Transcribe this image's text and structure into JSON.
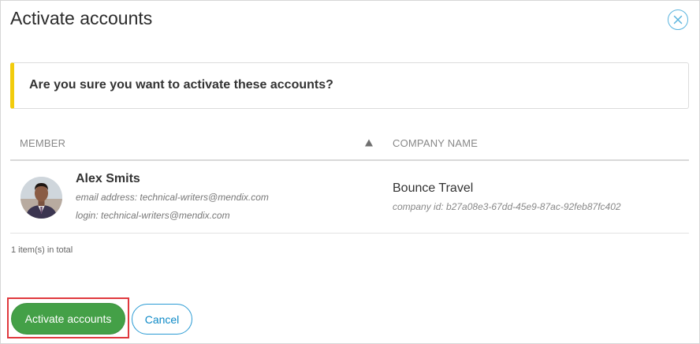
{
  "dialog": {
    "title": "Activate accounts",
    "close_icon": "close-circle-icon"
  },
  "alert": {
    "message": "Are you sure you want to activate these accounts?",
    "accent_color": "#f2cc0c"
  },
  "table": {
    "columns": [
      {
        "label": "MEMBER",
        "sort": "ascending"
      },
      {
        "label": "COMPANY NAME"
      }
    ],
    "rows": [
      {
        "member_name": "Alex Smits",
        "email": "email address: technical-writers@mendix.com",
        "login": "login: technical-writers@mendix.com",
        "company_name": "Bounce Travel",
        "company_id": "company id: b27a08e3-67dd-45e9-87ac-92feb87fc402"
      }
    ],
    "total": "1 item(s) in total"
  },
  "footer": {
    "primary_label": "Activate accounts",
    "secondary_label": "Cancel",
    "primary_color": "#44a047",
    "secondary_color": "#2a9bd4",
    "highlight_color": "#e0393e"
  }
}
